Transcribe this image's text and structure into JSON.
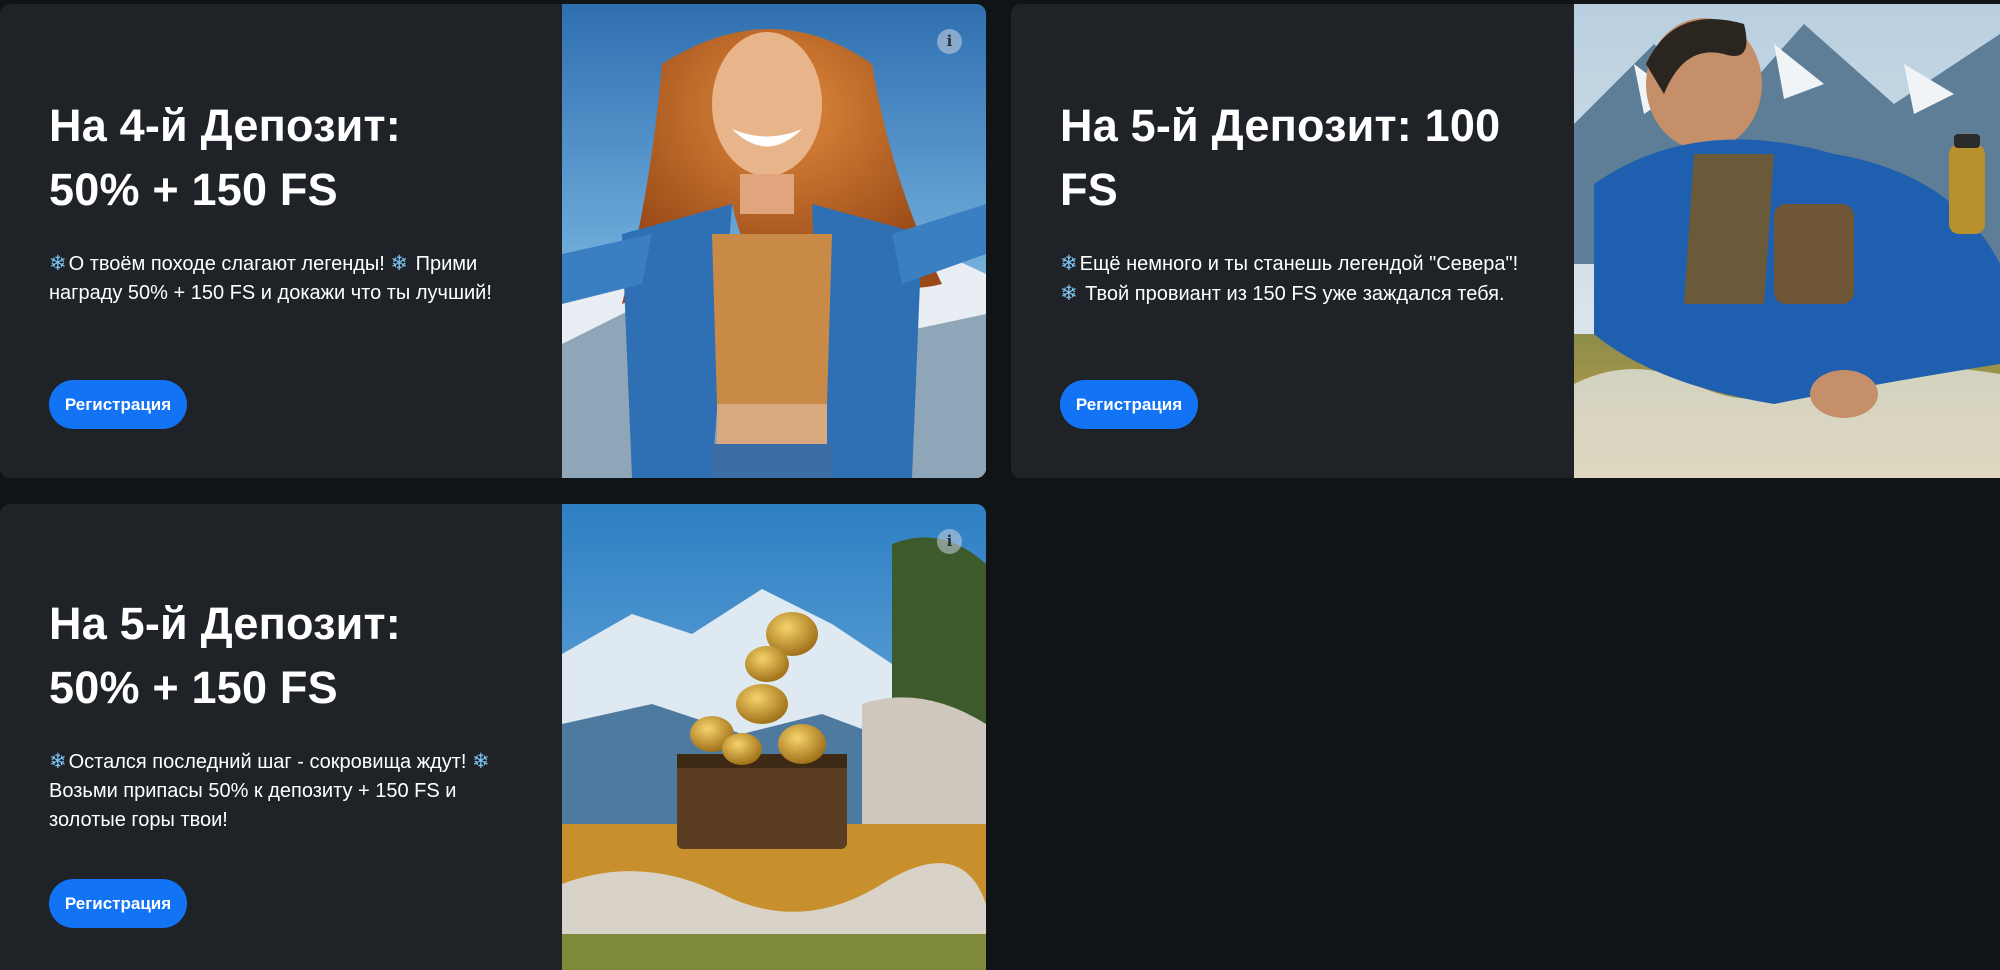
{
  "cards": [
    {
      "title_line1": "На 4-й Депозит:",
      "title_line2": "50% + 150 FS",
      "desc_1": "О твоём походе слагают легенды!",
      "desc_2": "Прими награду 50% + 150 FS и докажи что ты лучший!",
      "button_label": "Регистрация",
      "info_label": "i",
      "image": "woman-in-denim-jacket-mountains"
    },
    {
      "title_line1": "На 5-й Депозит: 100",
      "title_line2": "FS",
      "desc_1": "Ещё немного и ты станешь легендой \"Севера\"!",
      "desc_2": "Твой провиант из 150 FS уже заждался тебя.",
      "button_label": "Регистрация",
      "image": "man-resting-in-alpine-meadow"
    },
    {
      "title_line1": "На 5-й Депозит:",
      "title_line2": "50% + 150 FS",
      "desc_1": "Остался последний шаг - сокровища ждут!",
      "desc_2": "Возьми припасы 50% к депозиту + 150 FS и золотые горы твои!",
      "button_label": "Регистрация",
      "info_label": "i",
      "image": "treasure-chest-gold-cups-mountains"
    }
  ],
  "icons": {
    "snowflake": "❄"
  },
  "colors": {
    "page_bg": "#101417",
    "card_bg": "#1f2327",
    "button_bg": "#1274f5",
    "snowflake": "#7cc4f3"
  }
}
